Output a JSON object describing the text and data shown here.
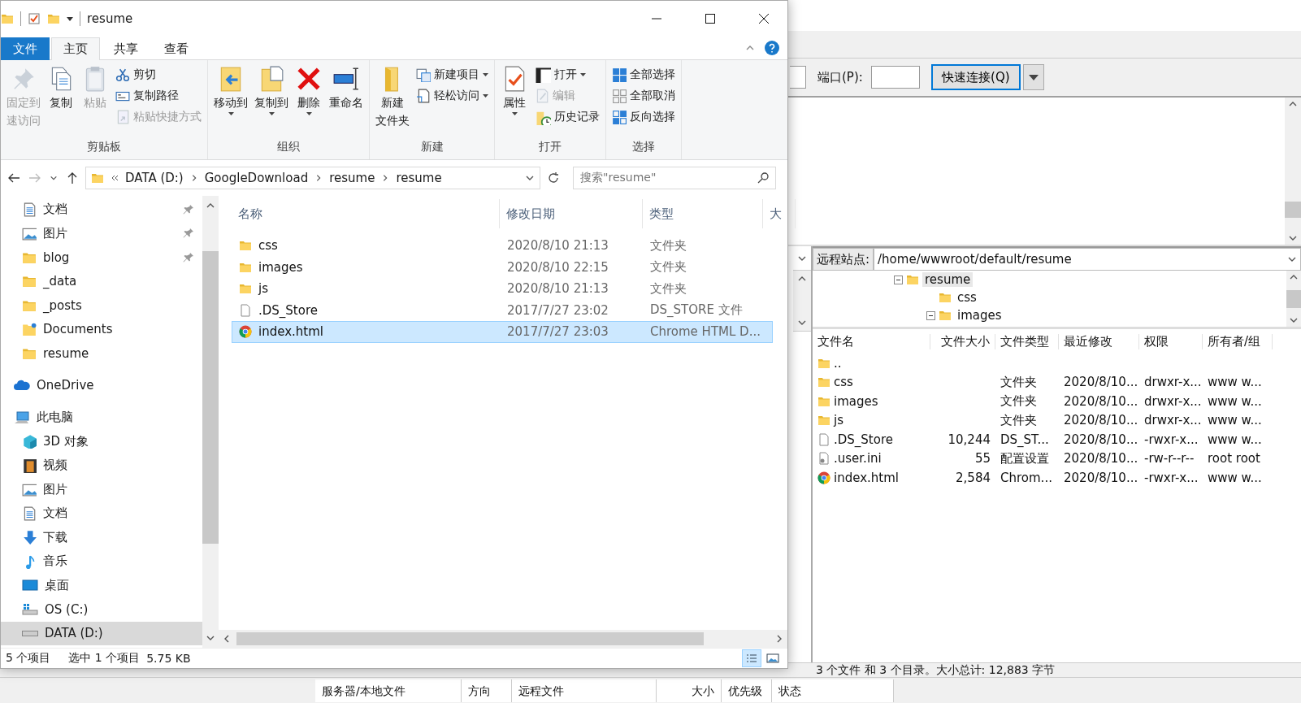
{
  "filezilla": {
    "quickconnect": {
      "port_label": "端口(P):",
      "connect_button": "快速连接(Q)"
    },
    "remote": {
      "site_label": "远程站点:",
      "path": "/home/wwwroot/default/resume",
      "tree": [
        {
          "label": "resume",
          "expanded": true,
          "selected": true,
          "children": [
            {
              "label": "css",
              "selected": false
            },
            {
              "label": "images",
              "expanded": true,
              "selected": false
            }
          ]
        }
      ],
      "columns": [
        "文件名",
        "文件大小",
        "文件类型",
        "最近修改",
        "权限",
        "所有者/组"
      ],
      "rows": [
        {
          "kind": "folder",
          "name": "..",
          "size": "",
          "type": "",
          "modified": "",
          "perms": "",
          "owner": ""
        },
        {
          "kind": "folder",
          "name": "css",
          "size": "",
          "type": "文件夹",
          "modified": "2020/8/10...",
          "perms": "drwxr-x...",
          "owner": "www w..."
        },
        {
          "kind": "folder",
          "name": "images",
          "size": "",
          "type": "文件夹",
          "modified": "2020/8/10...",
          "perms": "drwxr-x...",
          "owner": "www w..."
        },
        {
          "kind": "folder",
          "name": "js",
          "size": "",
          "type": "文件夹",
          "modified": "2020/8/10...",
          "perms": "drwxr-x...",
          "owner": "www w..."
        },
        {
          "kind": "file",
          "name": ".DS_Store",
          "size": "10,244",
          "type": "DS_ST...",
          "modified": "2020/8/10...",
          "perms": "-rwxr-x...",
          "owner": "www w..."
        },
        {
          "kind": "config",
          "name": ".user.ini",
          "size": "55",
          "type": "配置设置",
          "modified": "2020/8/10...",
          "perms": "-rw-r--r--",
          "owner": "root root"
        },
        {
          "kind": "chrome",
          "name": "index.html",
          "size": "2,584",
          "type": "Chrom...",
          "modified": "2020/8/10...",
          "perms": "-rwxr-x...",
          "owner": "www w..."
        }
      ],
      "status": "3 个文件 和 3 个目录。大小总计: 12,883 字节"
    },
    "queue_columns": [
      "服务器/本地文件",
      "方向",
      "远程文件",
      "大小",
      "优先级",
      "状态"
    ]
  },
  "explorer": {
    "title": "resume",
    "tabs": [
      {
        "label": "文件",
        "kind": "file",
        "selected": false
      },
      {
        "label": "主页",
        "kind": "tab",
        "selected": true
      },
      {
        "label": "共享",
        "kind": "tab",
        "selected": false
      },
      {
        "label": "查看",
        "kind": "tab",
        "selected": false
      }
    ],
    "ribbon_groups": [
      {
        "label": "剪贴板",
        "items": [
          {
            "kind": "large",
            "label": "固定到",
            "label2": "速访问",
            "disabled": true
          },
          {
            "kind": "large",
            "label": "复制",
            "disabled": false
          },
          {
            "kind": "large",
            "label": "粘贴",
            "disabled": true
          },
          {
            "kind": "small",
            "label": "剪切",
            "disabled": false
          },
          {
            "kind": "small",
            "label": "复制路径",
            "disabled": false
          },
          {
            "kind": "small",
            "label": "粘贴快捷方式",
            "disabled": true
          }
        ]
      },
      {
        "label": "组织",
        "items": [
          {
            "kind": "large",
            "label": "移动到",
            "caret": true,
            "disabled": false
          },
          {
            "kind": "large",
            "label": "复制到",
            "caret": true,
            "disabled": false
          },
          {
            "kind": "large",
            "label": "删除",
            "caret": true,
            "disabled": false
          },
          {
            "kind": "large",
            "label": "重命名",
            "disabled": false
          }
        ]
      },
      {
        "label": "新建",
        "items": [
          {
            "kind": "large",
            "label": "新建",
            "label2": "文件夹",
            "disabled": false
          },
          {
            "kind": "small",
            "label": "新建项目",
            "caret": true,
            "disabled": false
          },
          {
            "kind": "small",
            "label": "轻松访问",
            "caret": true,
            "disabled": false
          }
        ]
      },
      {
        "label": "打开",
        "items": [
          {
            "kind": "large",
            "label": "属性",
            "caret": true,
            "disabled": false
          },
          {
            "kind": "small",
            "label": "打开",
            "caret": true,
            "disabled": false
          },
          {
            "kind": "small",
            "label": "编辑",
            "disabled": true
          },
          {
            "kind": "small",
            "label": "历史记录",
            "disabled": false
          }
        ]
      },
      {
        "label": "选择",
        "items": [
          {
            "kind": "small",
            "label": "全部选择",
            "disabled": false
          },
          {
            "kind": "small",
            "label": "全部取消",
            "disabled": false
          },
          {
            "kind": "small",
            "label": "反向选择",
            "disabled": false
          }
        ]
      }
    ],
    "breadcrumbs": [
      "DATA (D:)",
      "GoogleDownload",
      "resume",
      "resume"
    ],
    "search": {
      "placeholder": "搜索\"resume\""
    },
    "quick_access": [
      {
        "label": "文档",
        "pinned": true,
        "selected": false
      },
      {
        "label": "图片",
        "pinned": true,
        "selected": false
      },
      {
        "label": "blog",
        "pinned": true,
        "selected": false
      },
      {
        "label": "_data",
        "pinned": false,
        "selected": false
      },
      {
        "label": "_posts",
        "pinned": false,
        "selected": false
      },
      {
        "label": "Documents",
        "pinned": false,
        "selected": false
      },
      {
        "label": "resume",
        "pinned": false,
        "selected": false
      }
    ],
    "roots": [
      {
        "label": "OneDrive",
        "selected": false
      },
      {
        "label": "此电脑",
        "selected": false,
        "children": [
          {
            "label": "3D 对象",
            "selected": false
          },
          {
            "label": "视频",
            "selected": false
          },
          {
            "label": "图片",
            "selected": false
          },
          {
            "label": "文档",
            "selected": false
          },
          {
            "label": "下载",
            "selected": false
          },
          {
            "label": "音乐",
            "selected": false
          },
          {
            "label": "桌面",
            "selected": false
          },
          {
            "label": "OS (C:)",
            "selected": false
          },
          {
            "label": "DATA (D:)",
            "selected": true
          }
        ]
      }
    ],
    "columns": [
      "名称",
      "修改日期",
      "类型",
      "大"
    ],
    "rows": [
      {
        "kind": "folder",
        "name": "css",
        "date": "2020/8/10 21:13",
        "type": "文件夹",
        "selected": false
      },
      {
        "kind": "folder",
        "name": "images",
        "date": "2020/8/10 22:15",
        "type": "文件夹",
        "selected": false
      },
      {
        "kind": "folder",
        "name": "js",
        "date": "2020/8/10 21:13",
        "type": "文件夹",
        "selected": false
      },
      {
        "kind": "file",
        "name": ".DS_Store",
        "date": "2017/7/27 23:02",
        "type": "DS_STORE 文件",
        "selected": false
      },
      {
        "kind": "chrome",
        "name": "index.html",
        "date": "2017/7/27 23:03",
        "type": "Chrome HTML D...",
        "selected": true
      }
    ],
    "status": {
      "count": "5 个项目",
      "selection": "选中 1 个项目",
      "size": "5.75 KB"
    }
  }
}
